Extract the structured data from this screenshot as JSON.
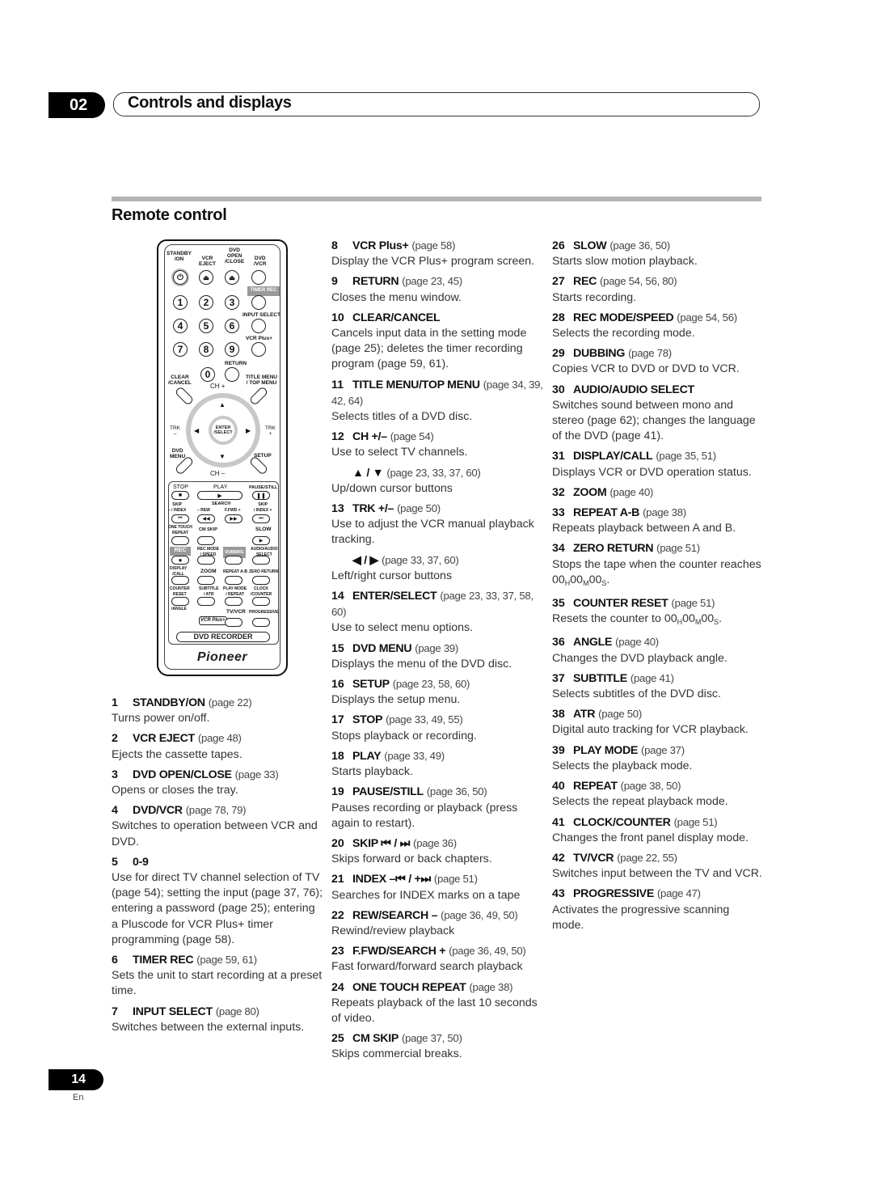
{
  "header": {
    "chapter_number": "02",
    "chapter_title": "Controls and displays"
  },
  "section": {
    "title": "Remote control"
  },
  "remote": {
    "labels": {
      "standby": "STANDBY\n/ON",
      "vcr_eject": "VCR\nEJECT",
      "dvd_open": "DVD\nOPEN\n/CLOSE",
      "dvd_vcr": "DVD\n/VCR",
      "timer_rec": "TIMER REC",
      "input_select": "INPUT SELECT",
      "vcr_plus": "VCR Plus+",
      "return": "RETURN",
      "clear": "CLEAR\n/CANCEL",
      "title_menu": "TITLE MENU\n/ TOP MENU",
      "ch_plus": "CH +",
      "ch_minus": "CH –",
      "trk_minus": "TRK\n–",
      "trk_plus": "TRK\n+",
      "enter": "ENTER\n/SELECT",
      "dvd_menu": "DVD\nMENU",
      "setup": "SETUP",
      "stop": "STOP",
      "play": "PLAY",
      "pause": "PAUSE/STILL",
      "skip_minus": "SKIP\n– / INDEX",
      "search": "SEARCH",
      "rew": "– REW",
      "ffwd": "F.FWD +",
      "skip_plus": "SKIP\n/ INDEX +",
      "one_touch": "ONE TOUCH\nREPEAT",
      "cm_skip": "CM SKIP",
      "slow": "SLOW",
      "rec": "REC",
      "rec_mode": "REC MODE\n/ SPEED",
      "dubbing": "DUBBING",
      "audio": "AUDIO/AUDIO\nSELECT",
      "display": "DISPLAY\n/CALL",
      "zoom": "ZOOM",
      "repeat_ab": "REPEAT A-B",
      "zero_return": "ZERO RETURN",
      "counter_reset": "COUNTER\nRESET",
      "subtitle": "SUBTITLE\n/ ATR",
      "play_mode": "PLAY MODE\n/ REPEAT",
      "clock": "CLOCK\n/COUNTER",
      "angle": "/ANGLE",
      "vcr_plus_logo": "VCR Plus+",
      "tv_vcr": "TV/VCR",
      "progressive": "PROGRESSIVE",
      "dvd_recorder": "DVD RECORDER",
      "brand": "Pioneer"
    },
    "digits": [
      "1",
      "2",
      "3",
      "4",
      "5",
      "6",
      "7",
      "8",
      "9",
      "0"
    ]
  },
  "columns": {
    "left": [
      {
        "num": "1",
        "name": "STANDBY/ON",
        "page": "(page 22)",
        "desc": "Turns power on/off."
      },
      {
        "num": "2",
        "name": "VCR EJECT",
        "page": "(page 48)",
        "desc": "Ejects the cassette tapes."
      },
      {
        "num": "3",
        "name": "DVD OPEN/CLOSE",
        "page": "(page 33)",
        "desc": "Opens or closes the tray."
      },
      {
        "num": "4",
        "name": "DVD/VCR",
        "page": "(page 78, 79)",
        "desc": "Switches to operation between VCR and DVD."
      },
      {
        "num": "5",
        "name": "0-9",
        "page": "",
        "desc": "Use for direct TV channel selection of TV (page 54); setting the input (page 37, 76); entering a password (page 25); entering a Pluscode for VCR Plus+ timer programming (page 58)."
      },
      {
        "num": "6",
        "name": "TIMER REC",
        "page": "(page 59, 61)",
        "desc": "Sets the unit to start recording at a preset time."
      },
      {
        "num": "7",
        "name": "INPUT SELECT",
        "page": "(page 80)",
        "desc": "Switches between the external inputs."
      }
    ],
    "middle": [
      {
        "num": "8",
        "name": "VCR Plus+",
        "page": "(page 58)",
        "desc": "Display the VCR Plus+ program screen."
      },
      {
        "num": "9",
        "name": "RETURN",
        "page": "(page 23, 45)",
        "desc": "Closes the menu window."
      },
      {
        "num": "10",
        "name": "CLEAR/CANCEL",
        "page": "",
        "desc": "Cancels input data in the setting mode (page 25); deletes the timer recording program (page 59, 61)."
      },
      {
        "num": "11",
        "name": "TITLE MENU/TOP MENU",
        "page": "(page 34, 39, 42, 64)",
        "desc": "Selects titles of a DVD disc."
      },
      {
        "num": "12",
        "name": "CH +/–",
        "page": "(page 54)",
        "desc": "Use to select TV channels."
      },
      {
        "num": "",
        "name": "▲ / ▼",
        "page": "(page 23, 33, 37, 60)",
        "desc": "Up/down cursor buttons",
        "indent": true
      },
      {
        "num": "13",
        "name": "TRK +/–",
        "page": "(page 50)",
        "desc": "Use to adjust the VCR manual playback tracking."
      },
      {
        "num": "",
        "name": "◀ / ▶",
        "page": "(page 33, 37, 60)",
        "desc": "Left/right cursor buttons",
        "indent": true
      },
      {
        "num": "14",
        "name": "ENTER/SELECT",
        "page": "(page 23, 33, 37, 58, 60)",
        "desc": "Use to select menu options."
      },
      {
        "num": "15",
        "name": "DVD MENU",
        "page": "(page 39)",
        "desc": "Displays the menu of the DVD disc."
      },
      {
        "num": "16",
        "name": "SETUP",
        "page": "(page 23, 58, 60)",
        "desc": "Displays the setup menu."
      },
      {
        "num": "17",
        "name": "STOP",
        "page": "(page 33, 49, 55)",
        "desc": "Stops playback or recording."
      },
      {
        "num": "18",
        "name": "PLAY",
        "page": "(page 33, 49)",
        "desc": "Starts playback."
      },
      {
        "num": "19",
        "name": "PAUSE/STILL",
        "page": "(page 36, 50)",
        "desc": "Pauses recording or playback (press again to restart)."
      },
      {
        "num": "20",
        "name": "SKIP ⏮ / ⏭",
        "page": "(page 36)",
        "desc": "Skips forward or back chapters."
      },
      {
        "num": "21",
        "name": "INDEX –⏮ / +⏭",
        "page": "(page 51)",
        "desc": "Searches for INDEX marks on a tape"
      },
      {
        "num": "22",
        "name": "REW/SEARCH –",
        "page": "(page 36, 49, 50)",
        "desc": "Rewind/review playback"
      },
      {
        "num": "23",
        "name": "F.FWD/SEARCH +",
        "page": "(page 36, 49, 50)",
        "desc": "Fast forward/forward search playback"
      },
      {
        "num": "24",
        "name": "ONE TOUCH REPEAT",
        "page": "(page 38)",
        "desc": "Repeats playback of the last 10 seconds of video."
      },
      {
        "num": "25",
        "name": "CM SKIP",
        "page": "(page 37, 50)",
        "desc": "Skips commercial breaks."
      }
    ],
    "right": [
      {
        "num": "26",
        "name": "SLOW",
        "page": "(page 36, 50)",
        "desc": "Starts slow motion playback."
      },
      {
        "num": "27",
        "name": "REC",
        "page": "(page 54, 56, 80)",
        "desc": "Starts recording."
      },
      {
        "num": "28",
        "name": "REC MODE/SPEED",
        "page": "(page 54, 56)",
        "desc": "Selects the recording mode."
      },
      {
        "num": "29",
        "name": "DUBBING",
        "page": "(page 78)",
        "desc": "Copies VCR to DVD or DVD to VCR."
      },
      {
        "num": "30",
        "name": "AUDIO/AUDIO SELECT",
        "page": "",
        "desc": "Switches sound between mono and stereo (page 62); changes the language of the DVD (page 41)."
      },
      {
        "num": "31",
        "name": "DISPLAY/CALL",
        "page": "(page 35, 51)",
        "desc": "Displays VCR or DVD operation status."
      },
      {
        "num": "32",
        "name": "ZOOM",
        "page": "(page 40)",
        "desc": ""
      },
      {
        "num": "33",
        "name": "REPEAT A-B",
        "page": "(page 38)",
        "desc": "Repeats playback between A and B."
      },
      {
        "num": "34",
        "name": "ZERO RETURN",
        "page": "(page 51)",
        "desc": "Stops the tape when the counter reaches 00H00M00S.",
        "counter": true
      },
      {
        "num": "35",
        "name": "COUNTER RESET",
        "page": "(page 51)",
        "desc": "Resets the counter to 00H00M00S.",
        "counter": true
      },
      {
        "num": "36",
        "name": "ANGLE",
        "page": "(page 40)",
        "desc": "Changes the DVD playback angle."
      },
      {
        "num": "37",
        "name": "SUBTITLE",
        "page": "(page 41)",
        "desc": "Selects subtitles of the DVD disc."
      },
      {
        "num": "38",
        "name": "ATR",
        "page": "(page 50)",
        "desc": "Digital auto tracking for VCR playback."
      },
      {
        "num": "39",
        "name": "PLAY MODE",
        "page": "(page 37)",
        "desc": "Selects the playback mode."
      },
      {
        "num": "40",
        "name": "REPEAT",
        "page": "(page 38, 50)",
        "desc": "Selects the repeat playback mode."
      },
      {
        "num": "41",
        "name": "CLOCK/COUNTER",
        "page": "(page 51)",
        "desc": "Changes the front panel display mode."
      },
      {
        "num": "42",
        "name": "TV/VCR",
        "page": "(page 22, 55)",
        "desc": "Switches input between the TV and VCR."
      },
      {
        "num": "43",
        "name": "PROGRESSIVE",
        "page": "(page 47)",
        "desc": "Activates the progressive scanning mode."
      }
    ]
  },
  "footer": {
    "page_number": "14",
    "language": "En"
  }
}
